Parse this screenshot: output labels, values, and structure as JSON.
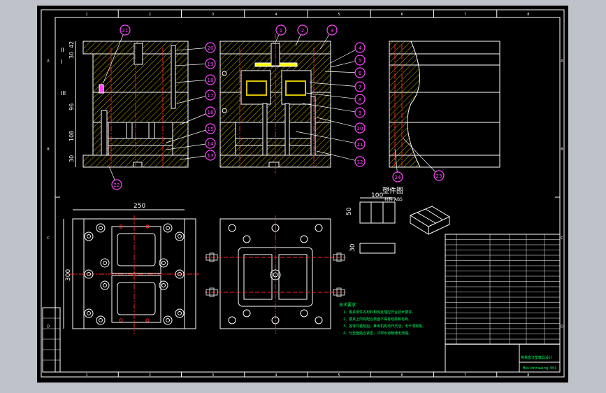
{
  "drawing": {
    "part_view_title": "塑件图",
    "part_view_subtitle": "材料 ABS",
    "dims": {
      "part_length": "100",
      "part_height": "50",
      "part_thickness": "30",
      "plate_width": "250",
      "plate_height": "300",
      "stack": [
        "42",
        "30",
        "96",
        "108",
        "30"
      ],
      "section_marks": [
        "II",
        "I",
        "III"
      ]
    },
    "balloons": [
      "1",
      "2",
      "3",
      "4",
      "5",
      "6",
      "7",
      "8",
      "9",
      "10",
      "11",
      "12",
      "13",
      "14",
      "15",
      "16",
      "17",
      "18",
      "19",
      "20",
      "21",
      "22",
      "23",
      "24"
    ],
    "border_letters_top": [
      "1",
      "2",
      "3",
      "4",
      "5",
      "6",
      "7",
      "8"
    ],
    "border_letters_side": [
      "A",
      "B",
      "C",
      "D"
    ],
    "notes_title": "技术要求：",
    "notes": [
      "1、模具零件的材料和热处理应符合技术要求。",
      "2、模具上所有配合表面不得有划痕和毛刺。",
      "3、各零件装配后，推出机构动作灵活，无卡滞现象。",
      "4、分型面贴合紧密，冷却水道畅通无泄漏。"
    ],
    "title_block": {
      "drawing_title": "简易盒注塑模具设计",
      "drawing_no": "Moulddrawing-001"
    }
  },
  "colors": {
    "background": "#000000",
    "frame": "#ffffff",
    "hatch": "#d9c200",
    "balloon": "#ff44ff",
    "centerline": "#ff2020",
    "text": "#00ff66",
    "cooling": "#d0d0d0"
  }
}
